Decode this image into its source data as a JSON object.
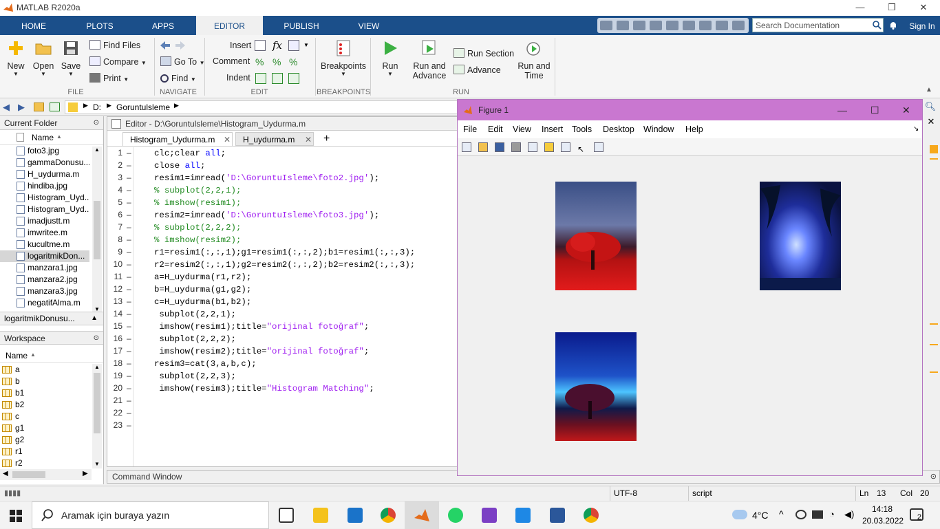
{
  "window_title": "MATLAB R2020a",
  "ribbon_tabs": [
    "HOME",
    "PLOTS",
    "APPS",
    "EDITOR",
    "PUBLISH",
    "VIEW"
  ],
  "search_placeholder": "Search Documentation",
  "sign_in": "Sign In",
  "ribbon": {
    "new": "New",
    "open": "Open",
    "save": "Save",
    "find_files": "Find Files",
    "compare": "Compare",
    "print": "Print",
    "go_to": "Go To",
    "find": "Find",
    "insert": "Insert",
    "comment": "Comment",
    "indent": "Indent",
    "breakpoints": "Breakpoints",
    "run": "Run",
    "run_and_advance_1": "Run and",
    "run_and_advance_2": "Advance",
    "run_section": "Run Section",
    "advance": "Advance",
    "run_and_time_1": "Run and",
    "run_and_time_2": "Time",
    "groups": [
      "FILE",
      "NAVIGATE",
      "EDIT",
      "BREAKPOINTS",
      "RUN"
    ]
  },
  "address": {
    "drive": "D:",
    "folder": "Goruntulsleme"
  },
  "current_folder": {
    "title": "Current Folder",
    "column": "Name",
    "files": [
      "foto3.jpg",
      "gammaDonusu...",
      "H_uydurma.m",
      "hindiba.jpg",
      "Histogram_Uyd...",
      "Histogram_Uyd...",
      "imadjustt.m",
      "imwritee.m",
      "kucultme.m",
      "logaritmikDon...",
      "manzara1.jpg",
      "manzara2.jpg",
      "manzara3.jpg",
      "negatifAlma.m"
    ],
    "selected_index": 9,
    "details": "logaritmikDonusu..."
  },
  "workspace": {
    "title": "Workspace",
    "column": "Name",
    "vars": [
      "a",
      "b",
      "b1",
      "b2",
      "c",
      "g1",
      "g2",
      "r1",
      "r2"
    ]
  },
  "editor": {
    "header": "Editor - D:\\Goruntulsleme\\Histogram_Uydurma.m",
    "tabs": [
      "Histogram_Uydurma.m",
      "H_uydurma.m"
    ],
    "active_tab": 0,
    "line_count": 23,
    "lines": [
      [
        [
          "p",
          "clc;clear "
        ],
        [
          "k",
          "all"
        ],
        [
          "p",
          ";"
        ]
      ],
      [
        [
          "p",
          "close "
        ],
        [
          "k",
          "all"
        ],
        [
          "p",
          ";"
        ]
      ],
      [
        [
          "p",
          "resim1=imread("
        ],
        [
          "s",
          "'D:\\GoruntuIsleme\\foto2.jpg'"
        ],
        [
          "p",
          ");"
        ]
      ],
      [
        [
          "c",
          "% subplot(2,2,1);"
        ]
      ],
      [
        [
          "c",
          "% imshow(resim1);"
        ]
      ],
      [
        [
          "p",
          "resim2=imread("
        ],
        [
          "s",
          "'D:\\GoruntuIsleme\\foto3.jpg'"
        ],
        [
          "p",
          ");"
        ]
      ],
      [
        [
          "c",
          "% subplot(2,2,2);"
        ]
      ],
      [
        [
          "c",
          "% imshow(resim2);"
        ]
      ],
      [
        [
          "p",
          "r1=resim1(:,:,1);g1=resim1(:,:,2);b1=resim1(:,:,3);"
        ]
      ],
      [
        [
          "p",
          "r2=resim2(:,:,1);g2=resim2(:,:,2);b2=resim2(:,:,3);"
        ]
      ],
      [
        [
          "p",
          "a=H_uydurma(r1,r2);"
        ]
      ],
      [
        [
          "p",
          "b=H_uydurma(g1,g2);"
        ]
      ],
      [
        [
          "p",
          "c=H_uydurma(b1,b2);"
        ]
      ],
      [
        [
          "p",
          " subplot(2,2,1);"
        ]
      ],
      [
        [
          "p",
          " imshow(resim1);title="
        ],
        [
          "s",
          "\"orijinal fotoğraf\""
        ],
        [
          "p",
          ";"
        ]
      ],
      [
        [
          "p",
          " subplot(2,2,2);"
        ]
      ],
      [
        [
          "p",
          " imshow(resim2);title="
        ],
        [
          "s",
          "\"orijinal fotoğraf\""
        ],
        [
          "p",
          ";"
        ]
      ],
      [
        [
          "p",
          "resim3=cat(3,a,b,c);"
        ]
      ],
      [
        [
          "p",
          " subplot(2,2,3);"
        ]
      ],
      [
        [
          "p",
          " imshow(resim3);title="
        ],
        [
          "s",
          "\"Histogram Matching\""
        ],
        [
          "p",
          ";"
        ]
      ],
      [],
      [],
      []
    ]
  },
  "command_window": "Command Window",
  "figure": {
    "title": "Figure 1",
    "menu": [
      "File",
      "Edit",
      "View",
      "Insert",
      "Tools",
      "Desktop",
      "Window",
      "Help"
    ]
  },
  "status": {
    "encoding": "UTF-8",
    "type": "script",
    "ln_label": "Ln",
    "ln": "13",
    "col_label": "Col",
    "col": "20"
  },
  "taskbar": {
    "search": "Aramak için buraya yazın",
    "temp": "4°C",
    "time": "14:18",
    "date": "20.03.2022",
    "notif": "2"
  },
  "colors": {
    "ribbon_tab_bar": "#1b4f8a",
    "figure_title": "#c977d0",
    "keyword": "#0000ff",
    "string": "#a020f0",
    "comment": "#228b22"
  }
}
